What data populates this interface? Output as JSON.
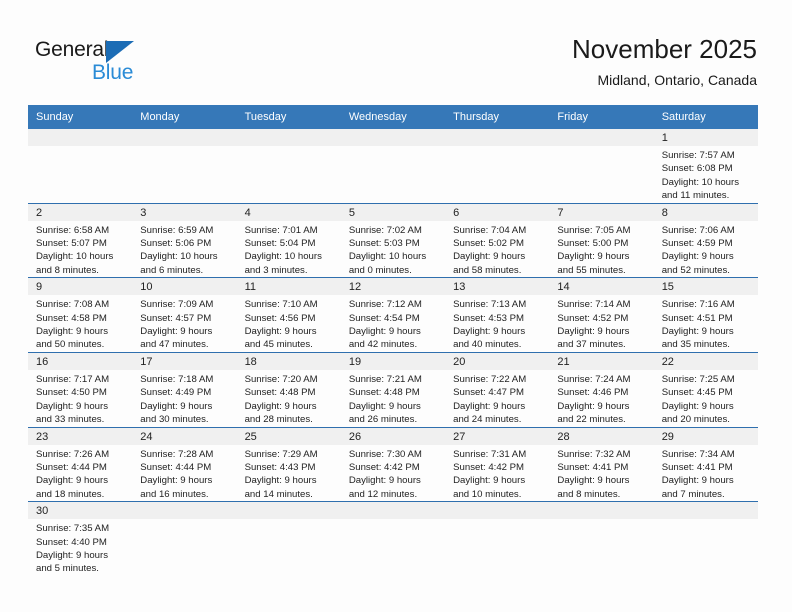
{
  "brand": {
    "name_top": "General",
    "name_bottom": "Blue",
    "accent_color": "#2a8bd6",
    "triangle_color": "#1b6cb5",
    "logo_icon": "triangle-flag-icon"
  },
  "header": {
    "title": "November 2025",
    "subtitle": "Midland, Ontario, Canada"
  },
  "theme": {
    "header_row_bg": "#3678b8",
    "header_row_text": "#ffffff",
    "row_separator": "#2f6fae",
    "daynum_band_bg": "#f0f0f0",
    "page_bg": "#fdfdfd",
    "body_text": "#222222"
  },
  "columns": [
    "Sunday",
    "Monday",
    "Tuesday",
    "Wednesday",
    "Thursday",
    "Friday",
    "Saturday"
  ],
  "weeks": [
    [
      {
        "blank": true,
        "day": ""
      },
      {
        "blank": true,
        "day": ""
      },
      {
        "blank": true,
        "day": ""
      },
      {
        "blank": true,
        "day": ""
      },
      {
        "blank": true,
        "day": ""
      },
      {
        "blank": true,
        "day": ""
      },
      {
        "blank": false,
        "day": "1",
        "sunrise": "Sunrise: 7:57 AM",
        "sunset": "Sunset: 6:08 PM",
        "daylight_1": "Daylight: 10 hours",
        "daylight_2": "and 11 minutes."
      }
    ],
    [
      {
        "blank": false,
        "day": "2",
        "sunrise": "Sunrise: 6:58 AM",
        "sunset": "Sunset: 5:07 PM",
        "daylight_1": "Daylight: 10 hours",
        "daylight_2": "and 8 minutes."
      },
      {
        "blank": false,
        "day": "3",
        "sunrise": "Sunrise: 6:59 AM",
        "sunset": "Sunset: 5:06 PM",
        "daylight_1": "Daylight: 10 hours",
        "daylight_2": "and 6 minutes."
      },
      {
        "blank": false,
        "day": "4",
        "sunrise": "Sunrise: 7:01 AM",
        "sunset": "Sunset: 5:04 PM",
        "daylight_1": "Daylight: 10 hours",
        "daylight_2": "and 3 minutes."
      },
      {
        "blank": false,
        "day": "5",
        "sunrise": "Sunrise: 7:02 AM",
        "sunset": "Sunset: 5:03 PM",
        "daylight_1": "Daylight: 10 hours",
        "daylight_2": "and 0 minutes."
      },
      {
        "blank": false,
        "day": "6",
        "sunrise": "Sunrise: 7:04 AM",
        "sunset": "Sunset: 5:02 PM",
        "daylight_1": "Daylight: 9 hours",
        "daylight_2": "and 58 minutes."
      },
      {
        "blank": false,
        "day": "7",
        "sunrise": "Sunrise: 7:05 AM",
        "sunset": "Sunset: 5:00 PM",
        "daylight_1": "Daylight: 9 hours",
        "daylight_2": "and 55 minutes."
      },
      {
        "blank": false,
        "day": "8",
        "sunrise": "Sunrise: 7:06 AM",
        "sunset": "Sunset: 4:59 PM",
        "daylight_1": "Daylight: 9 hours",
        "daylight_2": "and 52 minutes."
      }
    ],
    [
      {
        "blank": false,
        "day": "9",
        "sunrise": "Sunrise: 7:08 AM",
        "sunset": "Sunset: 4:58 PM",
        "daylight_1": "Daylight: 9 hours",
        "daylight_2": "and 50 minutes."
      },
      {
        "blank": false,
        "day": "10",
        "sunrise": "Sunrise: 7:09 AM",
        "sunset": "Sunset: 4:57 PM",
        "daylight_1": "Daylight: 9 hours",
        "daylight_2": "and 47 minutes."
      },
      {
        "blank": false,
        "day": "11",
        "sunrise": "Sunrise: 7:10 AM",
        "sunset": "Sunset: 4:56 PM",
        "daylight_1": "Daylight: 9 hours",
        "daylight_2": "and 45 minutes."
      },
      {
        "blank": false,
        "day": "12",
        "sunrise": "Sunrise: 7:12 AM",
        "sunset": "Sunset: 4:54 PM",
        "daylight_1": "Daylight: 9 hours",
        "daylight_2": "and 42 minutes."
      },
      {
        "blank": false,
        "day": "13",
        "sunrise": "Sunrise: 7:13 AM",
        "sunset": "Sunset: 4:53 PM",
        "daylight_1": "Daylight: 9 hours",
        "daylight_2": "and 40 minutes."
      },
      {
        "blank": false,
        "day": "14",
        "sunrise": "Sunrise: 7:14 AM",
        "sunset": "Sunset: 4:52 PM",
        "daylight_1": "Daylight: 9 hours",
        "daylight_2": "and 37 minutes."
      },
      {
        "blank": false,
        "day": "15",
        "sunrise": "Sunrise: 7:16 AM",
        "sunset": "Sunset: 4:51 PM",
        "daylight_1": "Daylight: 9 hours",
        "daylight_2": "and 35 minutes."
      }
    ],
    [
      {
        "blank": false,
        "day": "16",
        "sunrise": "Sunrise: 7:17 AM",
        "sunset": "Sunset: 4:50 PM",
        "daylight_1": "Daylight: 9 hours",
        "daylight_2": "and 33 minutes."
      },
      {
        "blank": false,
        "day": "17",
        "sunrise": "Sunrise: 7:18 AM",
        "sunset": "Sunset: 4:49 PM",
        "daylight_1": "Daylight: 9 hours",
        "daylight_2": "and 30 minutes."
      },
      {
        "blank": false,
        "day": "18",
        "sunrise": "Sunrise: 7:20 AM",
        "sunset": "Sunset: 4:48 PM",
        "daylight_1": "Daylight: 9 hours",
        "daylight_2": "and 28 minutes."
      },
      {
        "blank": false,
        "day": "19",
        "sunrise": "Sunrise: 7:21 AM",
        "sunset": "Sunset: 4:48 PM",
        "daylight_1": "Daylight: 9 hours",
        "daylight_2": "and 26 minutes."
      },
      {
        "blank": false,
        "day": "20",
        "sunrise": "Sunrise: 7:22 AM",
        "sunset": "Sunset: 4:47 PM",
        "daylight_1": "Daylight: 9 hours",
        "daylight_2": "and 24 minutes."
      },
      {
        "blank": false,
        "day": "21",
        "sunrise": "Sunrise: 7:24 AM",
        "sunset": "Sunset: 4:46 PM",
        "daylight_1": "Daylight: 9 hours",
        "daylight_2": "and 22 minutes."
      },
      {
        "blank": false,
        "day": "22",
        "sunrise": "Sunrise: 7:25 AM",
        "sunset": "Sunset: 4:45 PM",
        "daylight_1": "Daylight: 9 hours",
        "daylight_2": "and 20 minutes."
      }
    ],
    [
      {
        "blank": false,
        "day": "23",
        "sunrise": "Sunrise: 7:26 AM",
        "sunset": "Sunset: 4:44 PM",
        "daylight_1": "Daylight: 9 hours",
        "daylight_2": "and 18 minutes."
      },
      {
        "blank": false,
        "day": "24",
        "sunrise": "Sunrise: 7:28 AM",
        "sunset": "Sunset: 4:44 PM",
        "daylight_1": "Daylight: 9 hours",
        "daylight_2": "and 16 minutes."
      },
      {
        "blank": false,
        "day": "25",
        "sunrise": "Sunrise: 7:29 AM",
        "sunset": "Sunset: 4:43 PM",
        "daylight_1": "Daylight: 9 hours",
        "daylight_2": "and 14 minutes."
      },
      {
        "blank": false,
        "day": "26",
        "sunrise": "Sunrise: 7:30 AM",
        "sunset": "Sunset: 4:42 PM",
        "daylight_1": "Daylight: 9 hours",
        "daylight_2": "and 12 minutes."
      },
      {
        "blank": false,
        "day": "27",
        "sunrise": "Sunrise: 7:31 AM",
        "sunset": "Sunset: 4:42 PM",
        "daylight_1": "Daylight: 9 hours",
        "daylight_2": "and 10 minutes."
      },
      {
        "blank": false,
        "day": "28",
        "sunrise": "Sunrise: 7:32 AM",
        "sunset": "Sunset: 4:41 PM",
        "daylight_1": "Daylight: 9 hours",
        "daylight_2": "and 8 minutes."
      },
      {
        "blank": false,
        "day": "29",
        "sunrise": "Sunrise: 7:34 AM",
        "sunset": "Sunset: 4:41 PM",
        "daylight_1": "Daylight: 9 hours",
        "daylight_2": "and 7 minutes."
      }
    ],
    [
      {
        "blank": false,
        "day": "30",
        "sunrise": "Sunrise: 7:35 AM",
        "sunset": "Sunset: 4:40 PM",
        "daylight_1": "Daylight: 9 hours",
        "daylight_2": "and 5 minutes."
      },
      {
        "blank": true,
        "day": ""
      },
      {
        "blank": true,
        "day": ""
      },
      {
        "blank": true,
        "day": ""
      },
      {
        "blank": true,
        "day": ""
      },
      {
        "blank": true,
        "day": ""
      },
      {
        "blank": true,
        "day": ""
      }
    ]
  ]
}
